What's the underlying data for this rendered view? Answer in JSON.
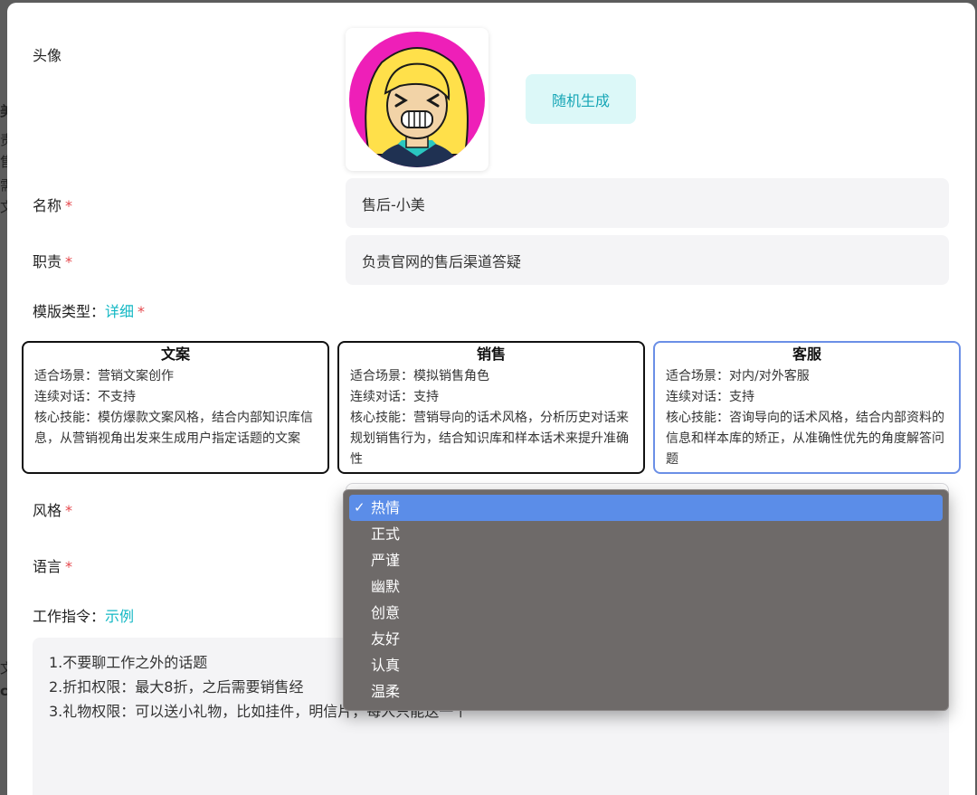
{
  "form": {
    "avatar_label": "头像",
    "random_button": "随机生成",
    "name_label": "名称",
    "name_value": "售后-小美",
    "duty_label": "职责",
    "duty_value": "负责官网的售后渠道答疑",
    "template_label": "模版类型：",
    "template_link": "详细",
    "style_label": "风格",
    "language_label": "语言",
    "instruction_label": "工作指令：",
    "instruction_link": "示例",
    "required_mark": "*",
    "instructions": [
      "1.不要聊工作之外的话题",
      "2.折扣权限：最大8折，之后需要销售经",
      "3.礼物权限：可以送小礼物，比如挂件，明信片，每人只能送一个"
    ]
  },
  "cards": [
    {
      "title": "文案",
      "lines": [
        "适合场景：营销文案创作",
        "连续对话：不支持",
        "核心技能：模仿爆款文案风格，结合内部知识库信息，从营销视角出发来生成用户指定话题的文案"
      ]
    },
    {
      "title": "销售",
      "lines": [
        "适合场景：模拟销售角色",
        "连续对话：支持",
        "核心技能：营销导向的话术风格，分析历史对话来规划销售行为，结合知识库和样本话术来提升准确性"
      ]
    },
    {
      "title": "客服",
      "lines": [
        "适合场景：对内/对外客服",
        "连续对话：支持",
        "核心技能：咨询导向的话术风格，结合内部资料的信息和样本库的矫正，从准确性优先的角度解答问题"
      ]
    }
  ],
  "dropdown": {
    "check_mark": "✓",
    "options": [
      "热情",
      "正式",
      "严谨",
      "幽默",
      "创意",
      "友好",
      "认真",
      "温柔"
    ],
    "selected": "热情"
  },
  "background_peek": [
    "美",
    "责",
    "售",
    "需",
    "文",
    "文",
    "c"
  ],
  "colors": {
    "accent": "#14b8c4",
    "required": "#e5484d",
    "selected_card_border": "#6b8fe6",
    "dropdown_bg": "#6e6a69",
    "dropdown_active": "#5b8de8"
  }
}
